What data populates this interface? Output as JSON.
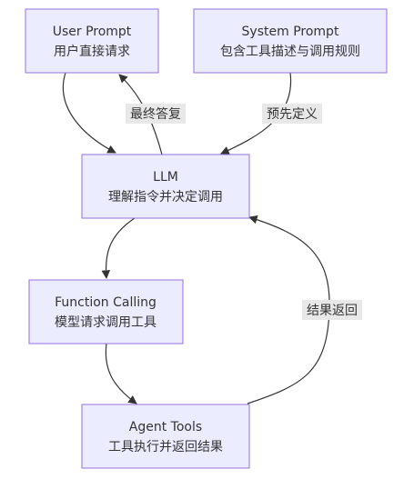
{
  "nodes": {
    "user_prompt": {
      "title": "User Prompt",
      "subtitle": "用户直接请求"
    },
    "system_prompt": {
      "title": "System Prompt",
      "subtitle": "包含工具描述与调用规则"
    },
    "llm": {
      "title": "LLM",
      "subtitle": "理解指令并决定调用"
    },
    "function_calling": {
      "title": "Function Calling",
      "subtitle": "模型请求调用工具"
    },
    "agent_tools": {
      "title": "Agent Tools",
      "subtitle": "工具执行并返回结果"
    }
  },
  "edges": {
    "final_answer": "最终答复",
    "predefine": "预先定义",
    "return_result": "结果返回"
  },
  "colors": {
    "node_fill": "#ECECFF",
    "node_stroke": "#9370DB",
    "edge": "#333333",
    "label_bg": "#e8e8e8",
    "text": "#333333"
  }
}
